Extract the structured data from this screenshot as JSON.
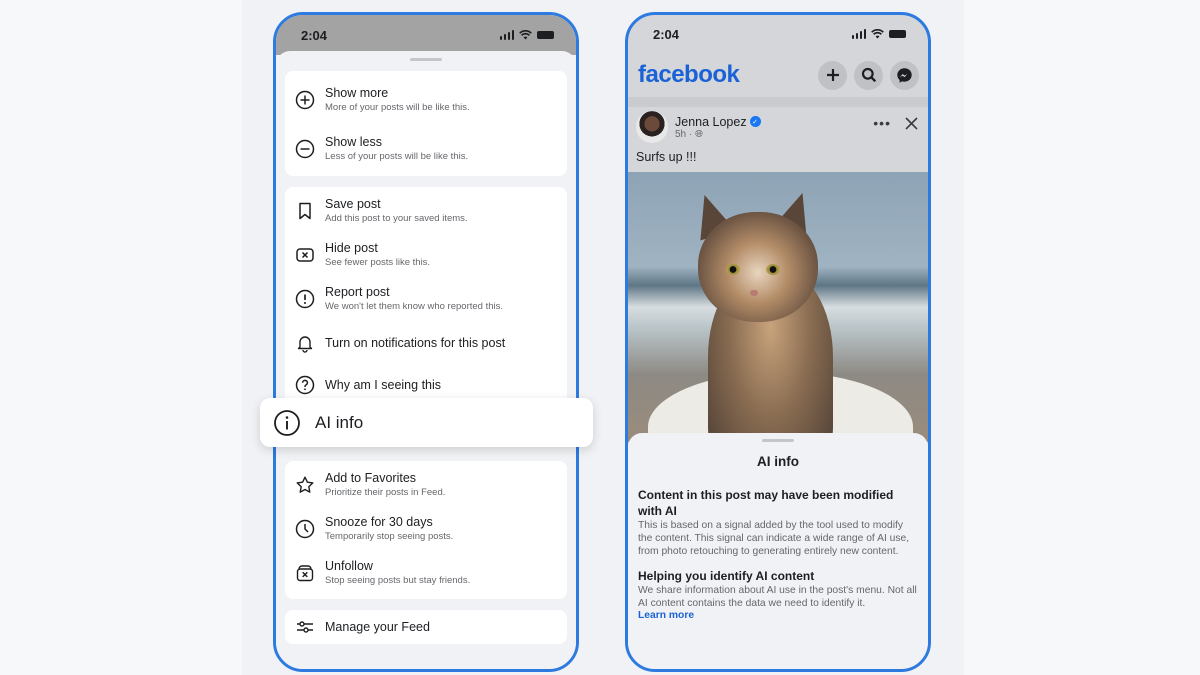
{
  "colors": {
    "accent": "#2d7ae0",
    "facebook_blue": "#1a62d6",
    "verified": "#1877f2",
    "text_primary": "#1c1e21",
    "text_secondary": "#65676b",
    "sheet_bg": "#f0f2f5"
  },
  "left_phone": {
    "status_time": "2:04",
    "status_icons": [
      "signal-icon",
      "wifi-icon",
      "battery-icon"
    ],
    "groups": [
      {
        "items": [
          {
            "icon": "plus-circle-icon",
            "title": "Show more",
            "subtitle": "More of your posts will be like this."
          },
          {
            "icon": "minus-circle-icon",
            "title": "Show less",
            "subtitle": "Less of your posts will be like this."
          }
        ]
      },
      {
        "items": [
          {
            "icon": "bookmark-icon",
            "title": "Save post",
            "subtitle": "Add this post to your saved items."
          },
          {
            "icon": "hide-x-box-icon",
            "title": "Hide post",
            "subtitle": "See fewer posts like this."
          },
          {
            "icon": "exclamation-circle-icon",
            "title": "Report post",
            "subtitle": "We won't let them know who reported this."
          },
          {
            "icon": "bell-icon",
            "title": "Turn on notifications for this post"
          },
          {
            "icon": "question-circle-icon",
            "title": "Why am I seeing this"
          }
        ]
      },
      {
        "items": [
          {
            "icon": "star-icon",
            "title": "Add to Favorites",
            "subtitle": "Prioritize their posts in Feed."
          },
          {
            "icon": "clock-icon",
            "title": "Snooze for 30 days",
            "subtitle": "Temporarily stop seeing posts."
          },
          {
            "icon": "unfollow-icon",
            "title": "Unfollow",
            "subtitle": "Stop seeing posts but stay friends."
          }
        ]
      },
      {
        "items": [
          {
            "icon": "sliders-icon",
            "title": "Manage your Feed"
          }
        ]
      }
    ],
    "highlighted_item": {
      "icon": "info-circle-icon",
      "title": "AI info"
    }
  },
  "right_phone": {
    "status_time": "2:04",
    "logo": "facebook",
    "header_buttons": [
      "plus-icon",
      "search-icon",
      "messenger-icon"
    ],
    "post": {
      "author": "Jenna Lopez",
      "verified": true,
      "time": "5h",
      "separator": "·",
      "audience_icon": "globe-icon",
      "caption": "Surfs up !!!",
      "image_description": "Tabby cat sitting on a surfboard at the beach"
    },
    "ai_sheet": {
      "title": "AI info",
      "section1_heading": "Content in this post may have been modified with AI",
      "section1_body": "This is based on a signal added by the tool used to modify the content. This signal can indicate a wide range of AI use, from photo retouching to generating entirely new content.",
      "section2_heading": "Helping you identify AI content",
      "section2_body": "We share information about AI use in the post's menu. Not all AI content contains the data we need to identify it.",
      "link": "Learn more"
    }
  }
}
